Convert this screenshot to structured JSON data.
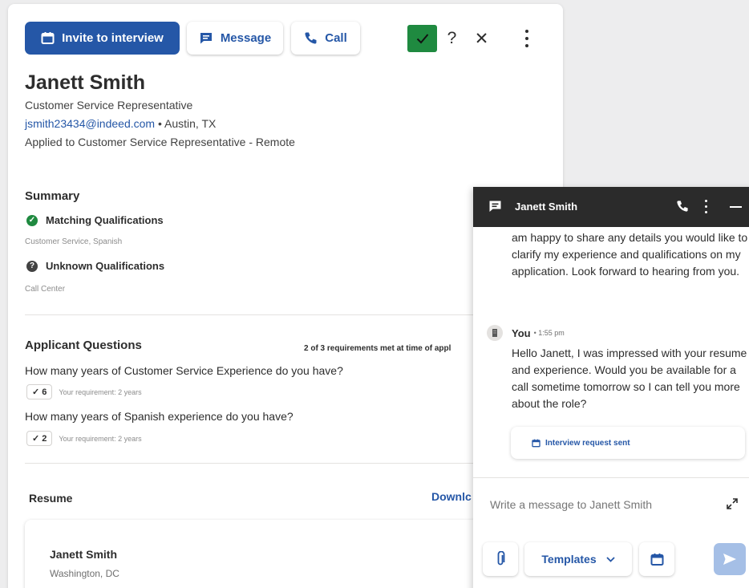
{
  "actions": {
    "invite_label": "Invite to interview",
    "message_label": "Message",
    "call_label": "Call",
    "status_yes": "✓",
    "status_maybe": "?",
    "status_no": "✕"
  },
  "candidate": {
    "name": "Janett Smith",
    "title": "Customer Service Representative",
    "email": "jsmith23434@indeed.com",
    "location": " • Austin, TX",
    "applied": "Applied to Customer Service Representative - Remote"
  },
  "summary": {
    "title": "Summary",
    "matching_label": "Matching Qualifications",
    "matching_items": "Customer Service, Spanish",
    "unknown_label": "Unknown Qualifications",
    "unknown_items": "Call Center"
  },
  "questions": {
    "title": "Applicant Questions",
    "requirements_note": "2 of 3 requirements met at time of appl",
    "items": [
      {
        "question": "How many years of Customer Service Experience do you have?",
        "answer": "✓ 6",
        "requirement": "Your requirement: 2 years"
      },
      {
        "question": "How many years of Spanish experience do you have?",
        "answer": "✓ 2",
        "requirement": "Your requirement: 2 years"
      }
    ]
  },
  "resume": {
    "label": "Resume",
    "download": "Downlc",
    "name": "Janett Smith",
    "location": "Washington, DC"
  },
  "chat": {
    "title": "Janett Smith",
    "incoming_text": "am happy to share any details you would like to clarify my experience and qualifications on my application. Look forward to hearing from you.",
    "you_label": "You",
    "you_time": "• 1:55 pm",
    "outgoing_text": "Hello Janett, I was impressed with your resume and experience. Would you be available for a call sometime tomorrow so I can tell you more about the role?",
    "interview_badge": "Interview request sent",
    "compose_placeholder": "Write a message to Janett Smith",
    "templates_label": "Templates"
  },
  "colors": {
    "brand_blue": "#2557a7",
    "success_green": "#1f8a40",
    "chat_header": "#2b2b2b",
    "send_disabled": "#a5bfe6"
  },
  "icons": {
    "invite": "calendar-icon",
    "message": "message-icon",
    "call": "phone-icon",
    "more": "more-vertical-icon",
    "attach": "paperclip-icon",
    "expand": "expand-icon",
    "send": "send-icon"
  }
}
